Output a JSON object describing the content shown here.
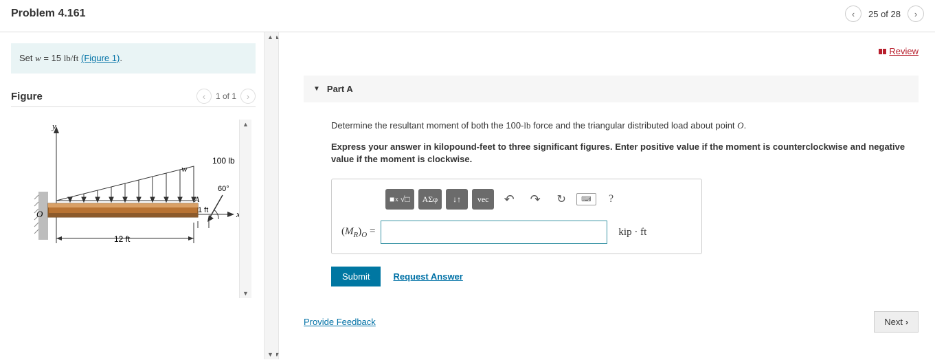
{
  "header": {
    "title": "Problem 4.161",
    "progress": "25 of 28"
  },
  "left": {
    "info_prefix": "Set ",
    "info_var": "w",
    "info_eq": " = 15 ",
    "info_unit": "lb/ft",
    "info_link": "(Figure 1)",
    "info_suffix": ".",
    "figure_title": "Figure",
    "figure_nav": "1 of 1",
    "diagram": {
      "y_label": "y",
      "x_label": "x",
      "O_label": "O",
      "A_label": "A",
      "w_label": "w",
      "force_label": "100 lb",
      "angle_label": "60°",
      "dim_a": "12 ft",
      "dim_b": "1 ft"
    }
  },
  "right": {
    "review": "Review",
    "part_label": "Part A",
    "question_p1": "Determine the resultant moment of both the 100-",
    "question_unit": "lb",
    "question_p2": " force and the triangular distributed load about point ",
    "question_pt": "O",
    "question_p3": ".",
    "hint": "Express your answer in kilopound-feet to three significant figures. Enter positive value if the moment is counterclockwise and negative value if the moment is clockwise.",
    "toolbar": {
      "t1": "■",
      "t1b": "√□",
      "t2": "ΑΣφ",
      "t3": "↓↑",
      "t4": "vec",
      "undo": "↶",
      "redo": "↷",
      "reset": "↻",
      "kbd": "⌨",
      "help": "?"
    },
    "lhs_pre": "(",
    "lhs_M": "M",
    "lhs_R": "R",
    "lhs_paren": ")",
    "lhs_O": "O",
    "lhs_eq": " =",
    "unit": "kip · ft",
    "submit": "Submit",
    "request": "Request Answer",
    "feedback": "Provide Feedback",
    "next": "Next"
  }
}
